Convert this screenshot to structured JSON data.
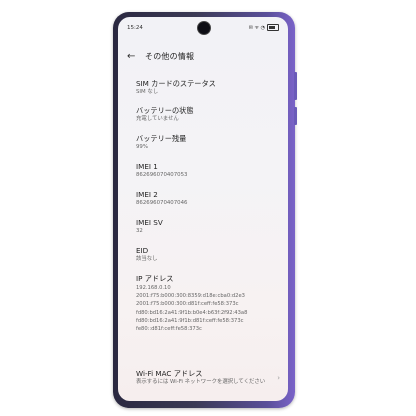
{
  "status_bar": {
    "time": "15:24",
    "icons": "✉ ᯤ ◔"
  },
  "header": {
    "back": "←",
    "title": "その他の情報"
  },
  "items": [
    {
      "label": "SIM カードのステータス",
      "value": "SIM なし"
    },
    {
      "label": "バッテリーの状態",
      "value": "充電していません"
    },
    {
      "label": "バッテリー残量",
      "value": "99%"
    },
    {
      "label": "IMEI 1",
      "value": "862696070407053"
    },
    {
      "label": "IMEI 2",
      "value": "862696070407046"
    },
    {
      "label": "IMEI SV",
      "value": "32"
    },
    {
      "label": "EID",
      "value": "該当なし"
    },
    {
      "label": "IP アドレス",
      "value": ""
    },
    {
      "label": "Wi-Fi MAC アドレス",
      "value": "表示するには Wi-Fi ネットワークを選択してください"
    }
  ],
  "ip_lines": [
    "192.168.0.10",
    "2001:f75:b000:300:8359:d18e:cba0:d2e3",
    "2001:f75:b000:300:d81f:ceff:fe58:373c",
    "fd80:bd16:2a41:9f1b:b0e4:b63f:2f92:43a8",
    "fd80:bd16:2a41:9f1b:d81f:ceff:fe58:373c",
    "fe80::d81f:ceff:fe58:373c"
  ],
  "wifi_chevron": "›"
}
